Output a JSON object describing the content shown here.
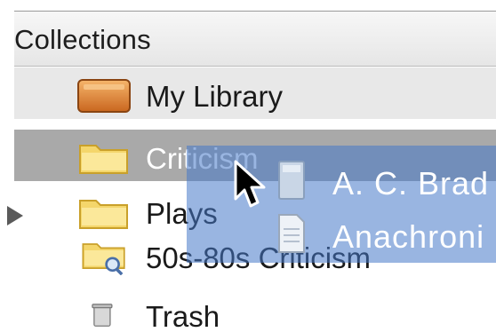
{
  "header": {
    "title": "Collections"
  },
  "sidebar": {
    "items": [
      {
        "label": "My Library",
        "icon": "library-icon"
      },
      {
        "label": "Criticism",
        "icon": "folder-icon",
        "selected": true
      },
      {
        "label": "Plays",
        "icon": "folder-icon"
      },
      {
        "label": "50s-80s Criticism",
        "icon": "smart-folder-icon"
      },
      {
        "label": "Trash",
        "icon": "trash-icon"
      }
    ]
  },
  "drag": {
    "items": [
      {
        "label": "A. C. Brad",
        "icon": "book-document-icon"
      },
      {
        "label": "Anachroni",
        "icon": "page-document-icon"
      }
    ]
  },
  "colors": {
    "selection": "#a9a9a9",
    "drag_overlay": "#4678c8"
  }
}
